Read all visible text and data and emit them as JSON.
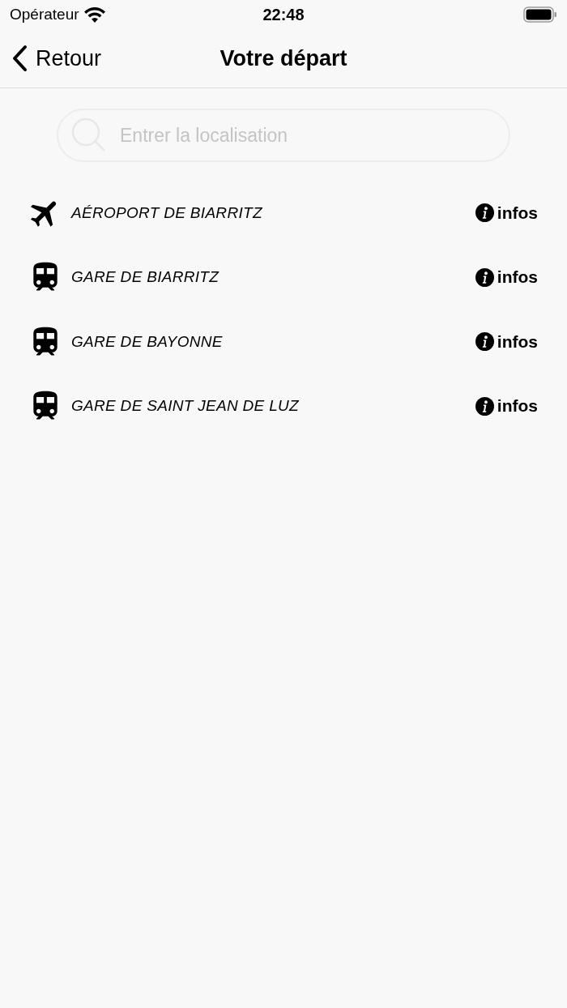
{
  "status_bar": {
    "carrier": "Opérateur",
    "time": "22:48"
  },
  "nav": {
    "back": "Retour",
    "title": "Votre départ"
  },
  "search": {
    "placeholder": "Entrer la localisation"
  },
  "places": [
    {
      "kind": "airport",
      "name": "AÉROPORT DE BIARRITZ",
      "action": "infos"
    },
    {
      "kind": "station",
      "name": "GARE DE BIARRITZ",
      "action": "infos"
    },
    {
      "kind": "station",
      "name": "GARE DE BAYONNE",
      "action": "infos"
    },
    {
      "kind": "station",
      "name": "GARE DE SAINT JEAN DE LUZ",
      "action": "infos"
    }
  ]
}
